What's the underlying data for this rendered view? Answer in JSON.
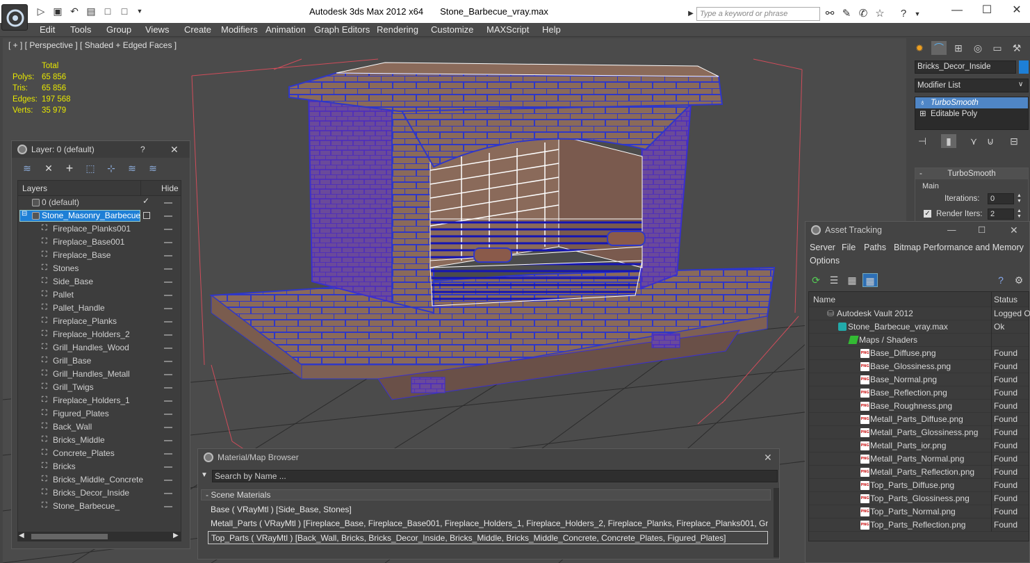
{
  "window": {
    "title": "Autodesk 3ds Max  2012 x64",
    "file": "Stone_Barbecue_vray.max",
    "search_placeholder": "Type a keyword or phrase"
  },
  "menu": [
    "Edit",
    "Tools",
    "Group",
    "Views",
    "Create",
    "Modifiers",
    "Animation",
    "Graph Editors",
    "Rendering",
    "Customize",
    "MAXScript",
    "Help"
  ],
  "viewport": {
    "label": "[ + ] [ Perspective ] [ Shaded + Edged Faces ]",
    "stats_header": "Total",
    "stats": [
      {
        "label": "Polys:",
        "value": "65 856"
      },
      {
        "label": "Tris:",
        "value": "65 856"
      },
      {
        "label": "Edges:",
        "value": "197 568"
      },
      {
        "label": "Verts:",
        "value": "35 979"
      }
    ]
  },
  "layer_panel": {
    "title": "Layer: 0 (default)",
    "help": "?",
    "col_layers": "Layers",
    "col_hide": "Hide",
    "default_layer": "0 (default)",
    "active_layer": "Stone_Masonry_Barbecue",
    "objects": [
      "Fireplace_Planks001",
      "Fireplace_Base001",
      "Fireplace_Base",
      "Stones",
      "Side_Base",
      "Pallet",
      "Pallet_Handle",
      "Fireplace_Planks",
      "Fireplace_Holders_2",
      "Grill_Handles_Wood",
      "Grill_Base",
      "Grill_Handles_Metall",
      "Grill_Twigs",
      "Fireplace_Holders_1",
      "Figured_Plates",
      "Back_Wall",
      "Bricks_Middle",
      "Concrete_Plates",
      "Bricks",
      "Bricks_Middle_Concrete",
      "Bricks_Decor_Inside",
      "Stone_Barbecue_"
    ]
  },
  "command_panel": {
    "object_name": "Bricks_Decor_Inside",
    "modifier_list": "Modifier List",
    "stack": [
      "TurboSmooth",
      "Editable Poly"
    ],
    "rollout": "TurboSmooth",
    "group": "Main",
    "iterations_label": "Iterations:",
    "iterations": "0",
    "render_iters_label": "Render Iters:",
    "render_iters": "2"
  },
  "asset_tracking": {
    "title": "Asset Tracking",
    "menu": [
      "Server",
      "File",
      "Paths",
      "Bitmap Performance and Memory",
      "Options"
    ],
    "col_name": "Name",
    "col_status": "Status",
    "vault": {
      "name": "Autodesk Vault 2012",
      "status": "Logged O"
    },
    "scene": {
      "name": "Stone_Barbecue_vray.max",
      "status": "Ok"
    },
    "maps_folder": "Maps / Shaders",
    "files": [
      {
        "name": "Base_Diffuse.png",
        "status": "Found"
      },
      {
        "name": "Base_Glossiness.png",
        "status": "Found"
      },
      {
        "name": "Base_Normal.png",
        "status": "Found"
      },
      {
        "name": "Base_Reflection.png",
        "status": "Found"
      },
      {
        "name": "Base_Roughness.png",
        "status": "Found"
      },
      {
        "name": "Metall_Parts_Diffuse.png",
        "status": "Found"
      },
      {
        "name": "Metall_Parts_Glossiness.png",
        "status": "Found"
      },
      {
        "name": "Metall_Parts_ior.png",
        "status": "Found"
      },
      {
        "name": "Metall_Parts_Normal.png",
        "status": "Found"
      },
      {
        "name": "Metall_Parts_Reflection.png",
        "status": "Found"
      },
      {
        "name": "Top_Parts_Diffuse.png",
        "status": "Found"
      },
      {
        "name": "Top_Parts_Glossiness.png",
        "status": "Found"
      },
      {
        "name": "Top_Parts_Normal.png",
        "status": "Found"
      },
      {
        "name": "Top_Parts_Reflection.png",
        "status": "Found"
      }
    ]
  },
  "material_browser": {
    "title": "Material/Map Browser",
    "search_placeholder": "Search by Name ...",
    "group": "- Scene Materials",
    "materials": [
      "Base  ( VRayMtl )  [Side_Base, Stones]",
      "Metall_Parts  ( VRayMtl )  [Fireplace_Base, Fireplace_Base001, Fireplace_Holders_1, Fireplace_Holders_2, Fireplace_Planks, Fireplace_Planks001, Grill_Base,...",
      "Top_Parts  ( VRayMtl )  [Back_Wall, Bricks, Bricks_Decor_Inside, Bricks_Middle, Bricks_Middle_Concrete, Concrete_Plates, Figured_Plates]"
    ]
  },
  "colors": {
    "selection": "#1e7fd6",
    "stats": "#e8e800",
    "wire": "#3a2fd0"
  }
}
